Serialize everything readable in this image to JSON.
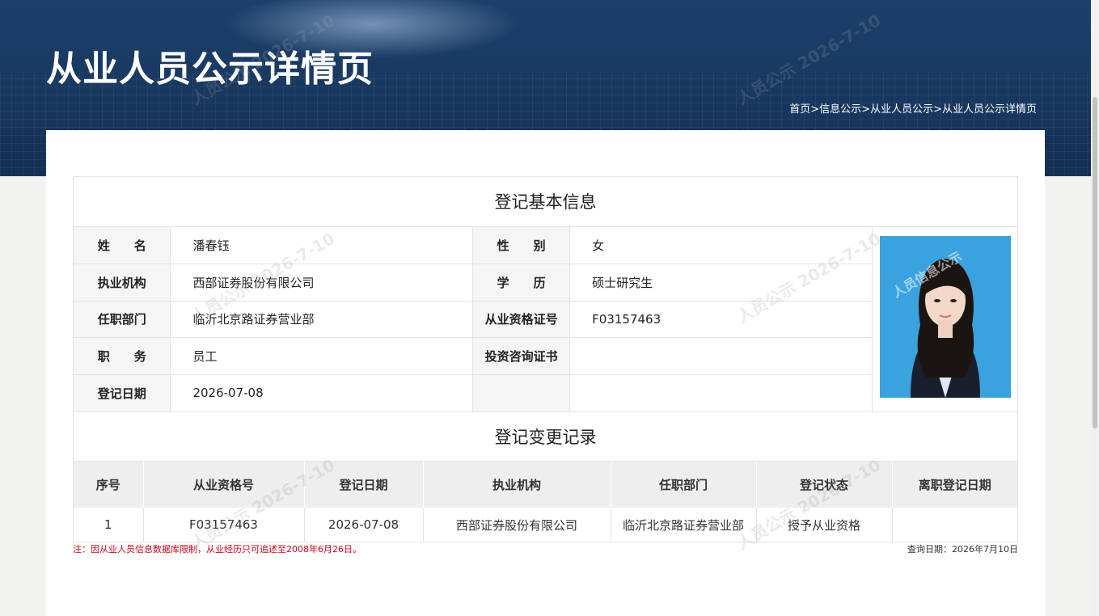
{
  "header": {
    "title": "从业人员公示详情页",
    "breadcrumb": [
      "首页",
      "信息公示",
      "从业人员公示",
      "从业人员公示详情页"
    ],
    "breadcrumb_separator": ">"
  },
  "basic_info": {
    "section_title": "登记基本信息",
    "rows": [
      {
        "label1": "姓　　名",
        "value1": "潘春钰",
        "label2": "性　　别",
        "value2": "女"
      },
      {
        "label1": "执业机构",
        "value1": "西部证券股份有限公司",
        "label2": "学　　历",
        "value2": "硕士研究生"
      },
      {
        "label1": "任职部门",
        "value1": "临沂北京路证券营业部",
        "label2": "从业资格证号",
        "value2": "F03157463"
      },
      {
        "label1": "职　　务",
        "value1": "员工",
        "label2": "投资咨询证书",
        "value2": ""
      },
      {
        "label1": "登记日期",
        "value1": "2026-07-08",
        "label2": "",
        "value2": ""
      }
    ],
    "photo_watermark": "人员信息公示"
  },
  "change_records": {
    "section_title": "登记变更记录",
    "columns": [
      "序号",
      "从业资格号",
      "登记日期",
      "执业机构",
      "任职部门",
      "登记状态",
      "离职登记日期"
    ],
    "rows": [
      [
        "1",
        "F03157463",
        "2026-07-08",
        "西部证券股份有限公司",
        "临沂北京路证券营业部",
        "授予从业资格",
        ""
      ]
    ]
  },
  "footer": {
    "note": "注：因从业人员信息数据库限制，从业经历只可追述至2008年6月26日。",
    "query_date": "查询日期：2026年7月10日"
  },
  "watermark": {
    "text": "人员公示 2026-7-10"
  },
  "colors": {
    "banner": "#1a3a63",
    "note_red": "#d0021b",
    "label_bg": "#f5f5f5",
    "header_bg": "#eeeeee"
  }
}
